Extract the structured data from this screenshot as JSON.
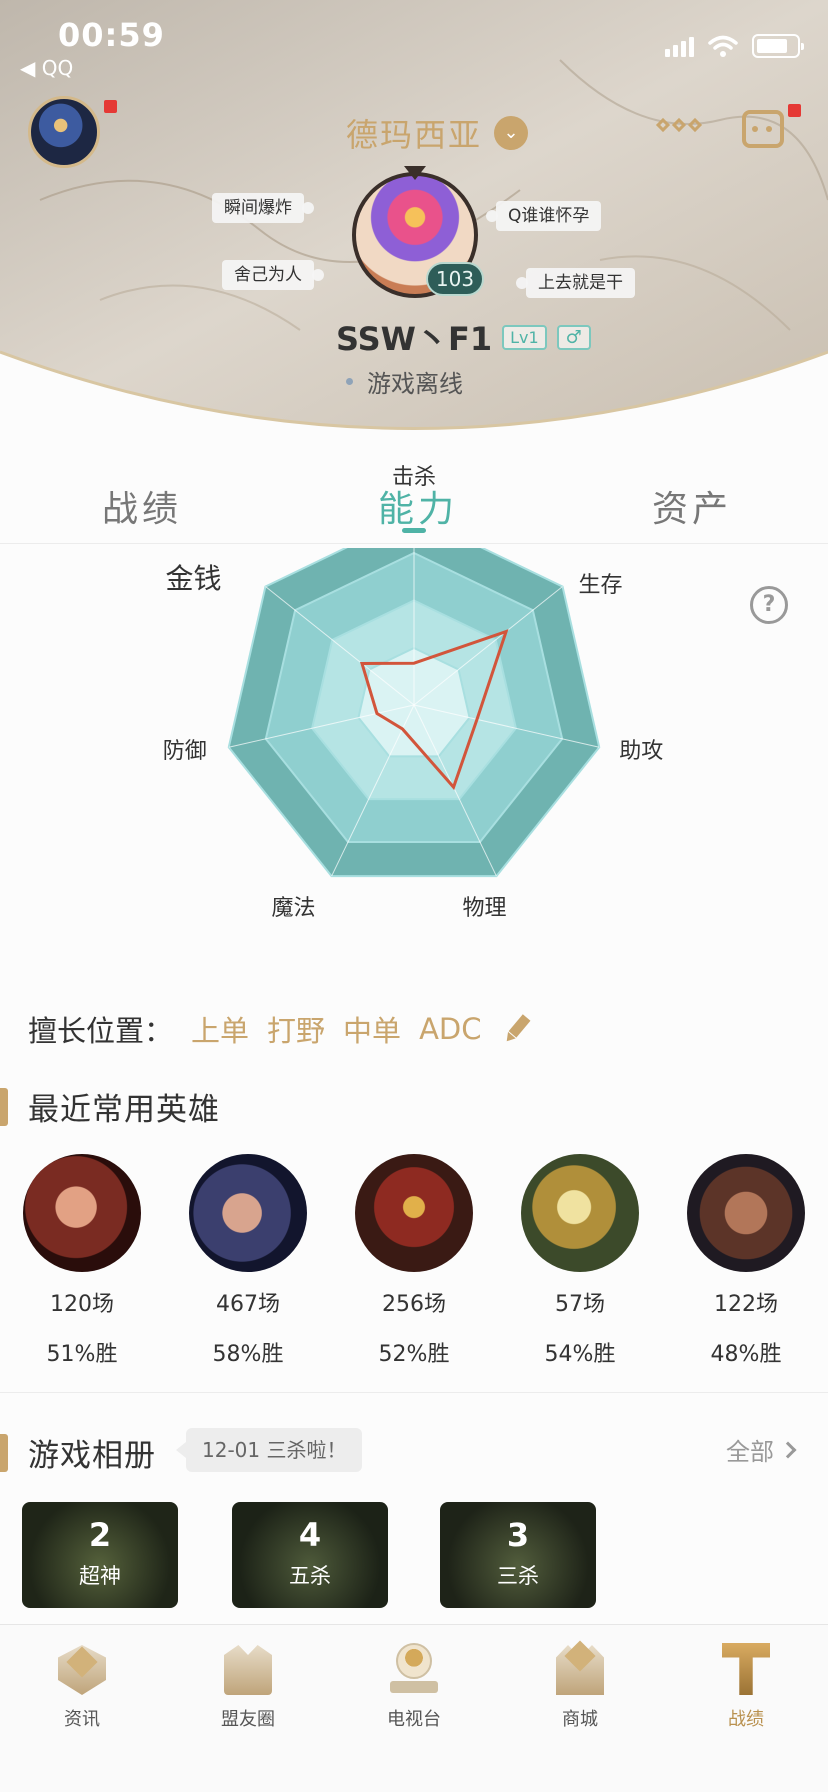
{
  "status_bar": {
    "time": "00:59",
    "back_label": "◀ QQ"
  },
  "header": {
    "server_name": "德玛西亚",
    "tags": [
      "瞬间爆炸",
      "舍己为人",
      "Q谁谁怀孕",
      "上去就是干"
    ],
    "level_badge": "103",
    "nickname": "SSW丶F1",
    "user_level": "Lv1",
    "gender_symbol": "♂",
    "online_status": "游戏离线"
  },
  "tabs": [
    {
      "label": "战绩",
      "active": false
    },
    {
      "label": "能力",
      "active": true
    },
    {
      "label": "资产",
      "active": false
    }
  ],
  "ability_radar": {
    "axes": [
      "击杀",
      "生存",
      "助攻",
      "物理",
      "魔法",
      "防御",
      "金钱"
    ],
    "values": [
      0.22,
      0.62,
      0.34,
      0.48,
      0.14,
      0.2,
      0.35
    ],
    "ring_levels": [
      0.3,
      0.55,
      0.8,
      1.0
    ],
    "grid_color": "#a8dfe0",
    "data_color": "#d2553b"
  },
  "positions": {
    "label": "擅长位置：",
    "items": [
      "上单",
      "打野",
      "中单",
      "ADC"
    ]
  },
  "recent_heroes": {
    "title": "最近常用英雄",
    "items": [
      {
        "games": "120场",
        "win_rate": "51%胜"
      },
      {
        "games": "467场",
        "win_rate": "58%胜"
      },
      {
        "games": "256场",
        "win_rate": "52%胜"
      },
      {
        "games": "57场",
        "win_rate": "54%胜"
      },
      {
        "games": "122场",
        "win_rate": "48%胜"
      }
    ]
  },
  "game_album": {
    "title": "游戏相册",
    "tip": "12-01 三杀啦！",
    "view_all": "全部",
    "items": [
      {
        "count": "2",
        "label": "超神"
      },
      {
        "count": "4",
        "label": "五杀"
      },
      {
        "count": "3",
        "label": "三杀"
      }
    ]
  },
  "bottom_nav": [
    {
      "label": "资讯",
      "icon": "news-shield-icon",
      "active": false
    },
    {
      "label": "盟友圈",
      "icon": "friends-circle-icon",
      "active": false
    },
    {
      "label": "电视台",
      "icon": "tv-station-icon",
      "active": false
    },
    {
      "label": "商城",
      "icon": "shop-icon",
      "active": false
    },
    {
      "label": "战绩",
      "icon": "records-icon",
      "active": true
    }
  ]
}
